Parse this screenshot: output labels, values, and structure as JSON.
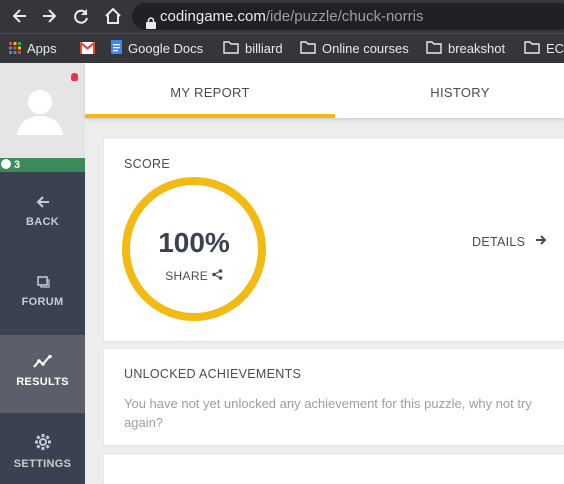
{
  "browser": {
    "url_host": "codingame.com",
    "url_path": "/ide/puzzle/chuck-norris",
    "bookmarks": [
      {
        "label": "Apps",
        "icon": "apps-grid-icon"
      },
      {
        "label": "",
        "icon": "gmail-icon"
      },
      {
        "label": "Google Docs",
        "icon": "google-docs-icon"
      },
      {
        "label": "billiard",
        "icon": "folder-icon"
      },
      {
        "label": "Online courses",
        "icon": "folder-icon"
      },
      {
        "label": "breakshot",
        "icon": "folder-icon"
      },
      {
        "label": "EC",
        "icon": "folder-icon"
      }
    ]
  },
  "sidebar": {
    "level": "3",
    "items": [
      {
        "label": "BACK",
        "icon": "back-arrow-icon"
      },
      {
        "label": "FORUM",
        "icon": "forum-icon"
      },
      {
        "label": "RESULTS",
        "icon": "results-chart-icon"
      },
      {
        "label": "SETTINGS",
        "icon": "gear-icon"
      }
    ]
  },
  "tabs": [
    {
      "label": "MY REPORT",
      "active": true
    },
    {
      "label": "HISTORY",
      "active": false
    }
  ],
  "score": {
    "title": "SCORE",
    "value": "100%",
    "share_label": "SHARE",
    "details_label": "DETAILS"
  },
  "achievements": {
    "title": "UNLOCKED ACHIEVEMENTS",
    "message": "You have not yet unlocked any achievement for this puzzle, why not try again?"
  },
  "colors": {
    "accent": "#f2bb13",
    "sidebar": "#3a4150",
    "level_bar": "#3d8a5a",
    "notification": "#f2304c"
  }
}
